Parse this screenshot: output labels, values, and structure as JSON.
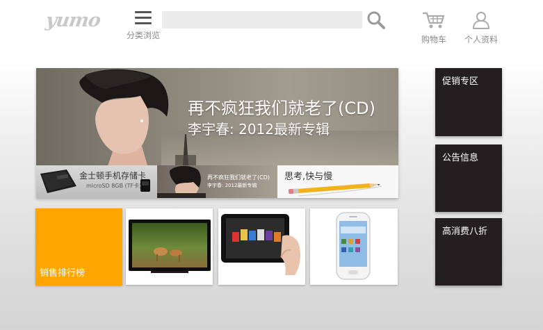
{
  "header": {
    "logo_text": "yumo",
    "menu_label": "分类浏览",
    "search_placeholder": "",
    "cart_label": "购物车",
    "profile_label": "个人资料"
  },
  "banner": {
    "title": "再不疯狂我们就老了(CD)",
    "subtitle": "李宇春: 2012最新专辑",
    "thumbs": [
      {
        "title": "金士顿手机存储卡",
        "subtitle": "microSD 8GB (TF卡)"
      },
      {
        "title": "再不疯狂我们就老了(CD)",
        "subtitle": "李宇春: 2012最新专辑"
      },
      {
        "title": "思考,快与慢"
      }
    ]
  },
  "tiles": {
    "rank_label": "销售排行榜",
    "tv": "television",
    "tablet": "tablet",
    "phone": "smartphone"
  },
  "sidebar": {
    "items": [
      {
        "label": "促销专区"
      },
      {
        "label": "公告信息"
      },
      {
        "label": "高消费八折"
      }
    ]
  },
  "colors": {
    "orange": "#ffa500",
    "dark_tile": "#231f20",
    "header_gray": "#8a8a8a",
    "search_bg": "#ececec"
  }
}
